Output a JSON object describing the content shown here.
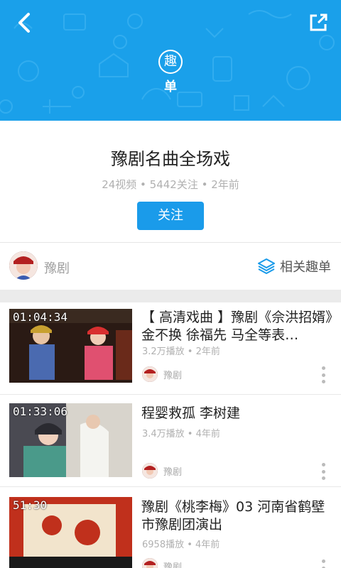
{
  "header": {
    "badge_char": "趣",
    "badge_sub": "单",
    "accent": "#1aa0ea"
  },
  "playlist": {
    "title": "豫剧名曲全场戏",
    "meta": "24视频 • 5442关注 • 2年前",
    "follow_label": "关注",
    "author_name": "豫剧",
    "related_label": "相关趣单"
  },
  "videos": [
    {
      "duration": "01:04:34",
      "title": "【 高清戏曲 】豫剧《佘洪招婿》金不换 徐福先 马全等表…",
      "stats": "3.2万播放 • 2年前",
      "author": "豫剧"
    },
    {
      "duration": "01:33:06",
      "title": "程婴救孤 李树建",
      "stats": "3.4万播放 • 4年前",
      "author": "豫剧"
    },
    {
      "duration": "51:30",
      "title": "豫剧《桃李梅》03 河南省鹤壁市豫剧团演出",
      "stats": "6958播放 • 4年前",
      "author": "豫剧"
    }
  ]
}
